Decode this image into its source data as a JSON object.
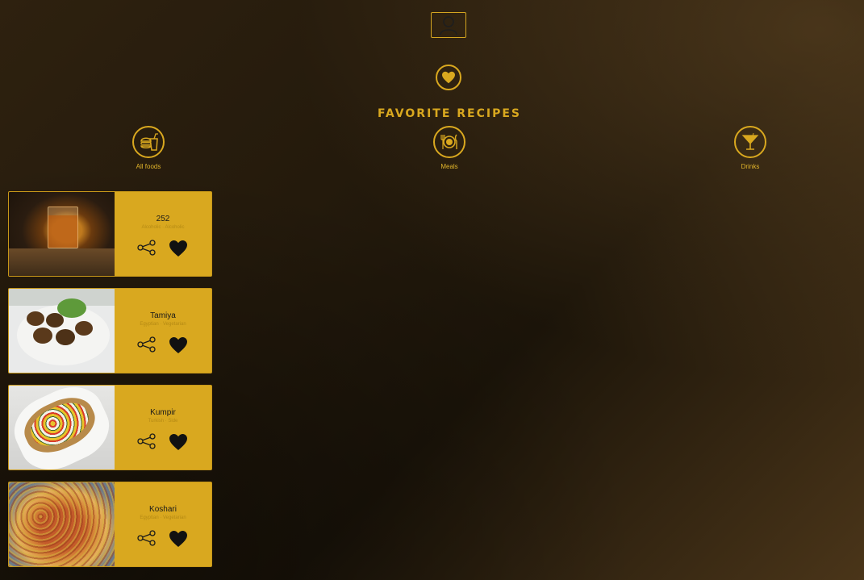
{
  "header": {
    "title": "FAVORITE RECIPES",
    "profile_icon": "user-icon",
    "favorites_icon": "heart-circle-icon"
  },
  "categories": [
    {
      "label": "All foods",
      "icon": "fast-food-icon"
    },
    {
      "label": "Meals",
      "icon": "plate-icon"
    },
    {
      "label": "Drinks",
      "icon": "cocktail-icon"
    }
  ],
  "recipes": [
    {
      "name": "252",
      "meta": "Alcoholic · Alcoholic",
      "image": "whiskey-glass-photo"
    },
    {
      "name": "Tamiya",
      "meta": "Egyptian · Vegetarian",
      "image": "falafel-photo"
    },
    {
      "name": "Kumpir",
      "meta": "Turkish · Side",
      "image": "baked-potato-photo"
    },
    {
      "name": "Koshari",
      "meta": "Egyptian · Vegetarian",
      "image": "koshari-photo"
    }
  ],
  "colors": {
    "accent": "#d9a81f",
    "card_bg": "#d9a81f",
    "text_dark": "#1a1a1a"
  }
}
